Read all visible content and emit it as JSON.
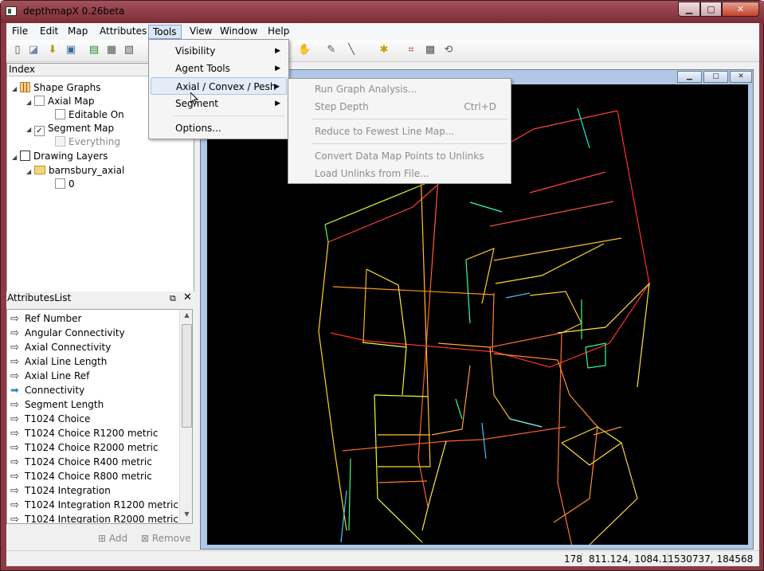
{
  "window": {
    "title": "depthmapX 0.26beta",
    "controls": [
      "minimize",
      "maximize",
      "close"
    ]
  },
  "menubar": {
    "items": [
      "File",
      "Edit",
      "Map",
      "Attributes",
      "Tools",
      "View",
      "Window",
      "Help"
    ],
    "open": "Tools"
  },
  "index": {
    "title": "Index",
    "rows": [
      {
        "label": "Shape Graphs",
        "kind": "group"
      },
      {
        "label": "Axial Map",
        "checked": false
      },
      {
        "label": "Editable On",
        "checked": false
      },
      {
        "label": "Segment Map",
        "checked": true
      },
      {
        "label": "Everything",
        "checked": false,
        "disabled": true
      },
      {
        "label": "Drawing Layers",
        "kind": "group"
      },
      {
        "label": "barnsbury_axial",
        "kind": "folder"
      },
      {
        "label": "0",
        "checked": false
      }
    ]
  },
  "attributes": {
    "title": "AttributesList",
    "float_label": "⧉",
    "close_label": "✕",
    "items": [
      "Ref Number",
      "Angular Connectivity",
      "Axial Connectivity",
      "Axial Line Length",
      "Axial Line Ref",
      "Connectivity",
      "Segment Length",
      "T1024 Choice",
      "T1024 Choice R1200 metric",
      "T1024 Choice R2000 metric",
      "T1024 Choice R400 metric",
      "T1024 Choice R800 metric",
      "T1024 Integration",
      "T1024 Integration R1200 metric",
      "T1024 Integration R2000 metric"
    ],
    "active_item": "Connectivity",
    "add_label": "Add",
    "remove_label": "Remove"
  },
  "tools_menu": {
    "items": [
      "Visibility",
      "Agent Tools",
      "Axial / Convex / Pesh",
      "Segment",
      "Options..."
    ],
    "highlighted": "Axial / Convex / Pesh"
  },
  "axial_submenu": {
    "items": [
      "Run Graph Analysis...",
      "Step Depth",
      "Reduce to Fewest Line Map...",
      "Convert Data Map Points to Unlinks",
      "Load Unlinks from File..."
    ],
    "step_depth_shortcut": "Ctrl+D"
  },
  "statusbar": {
    "count": "178",
    "coords": "811.124,  1084.11",
    "world": "530737,  184568"
  },
  "colors": {
    "titlebar": "#8b3a45",
    "map_bg": "#000000",
    "highlight": "#e3ecf7"
  }
}
